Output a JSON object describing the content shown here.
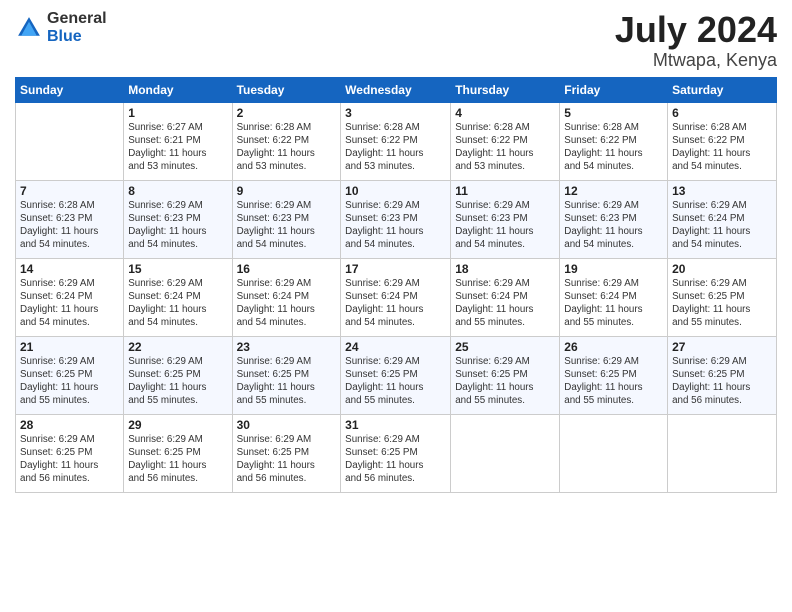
{
  "logo": {
    "general": "General",
    "blue": "Blue"
  },
  "title": {
    "month": "July 2024",
    "location": "Mtwapa, Kenya"
  },
  "headers": [
    "Sunday",
    "Monday",
    "Tuesday",
    "Wednesday",
    "Thursday",
    "Friday",
    "Saturday"
  ],
  "weeks": [
    [
      {
        "day": "",
        "info": ""
      },
      {
        "day": "1",
        "info": "Sunrise: 6:27 AM\nSunset: 6:21 PM\nDaylight: 11 hours\nand 53 minutes."
      },
      {
        "day": "2",
        "info": "Sunrise: 6:28 AM\nSunset: 6:22 PM\nDaylight: 11 hours\nand 53 minutes."
      },
      {
        "day": "3",
        "info": "Sunrise: 6:28 AM\nSunset: 6:22 PM\nDaylight: 11 hours\nand 53 minutes."
      },
      {
        "day": "4",
        "info": "Sunrise: 6:28 AM\nSunset: 6:22 PM\nDaylight: 11 hours\nand 53 minutes."
      },
      {
        "day": "5",
        "info": "Sunrise: 6:28 AM\nSunset: 6:22 PM\nDaylight: 11 hours\nand 54 minutes."
      },
      {
        "day": "6",
        "info": "Sunrise: 6:28 AM\nSunset: 6:22 PM\nDaylight: 11 hours\nand 54 minutes."
      }
    ],
    [
      {
        "day": "7",
        "info": "Sunrise: 6:28 AM\nSunset: 6:23 PM\nDaylight: 11 hours\nand 54 minutes."
      },
      {
        "day": "8",
        "info": "Sunrise: 6:29 AM\nSunset: 6:23 PM\nDaylight: 11 hours\nand 54 minutes."
      },
      {
        "day": "9",
        "info": "Sunrise: 6:29 AM\nSunset: 6:23 PM\nDaylight: 11 hours\nand 54 minutes."
      },
      {
        "day": "10",
        "info": "Sunrise: 6:29 AM\nSunset: 6:23 PM\nDaylight: 11 hours\nand 54 minutes."
      },
      {
        "day": "11",
        "info": "Sunrise: 6:29 AM\nSunset: 6:23 PM\nDaylight: 11 hours\nand 54 minutes."
      },
      {
        "day": "12",
        "info": "Sunrise: 6:29 AM\nSunset: 6:23 PM\nDaylight: 11 hours\nand 54 minutes."
      },
      {
        "day": "13",
        "info": "Sunrise: 6:29 AM\nSunset: 6:24 PM\nDaylight: 11 hours\nand 54 minutes."
      }
    ],
    [
      {
        "day": "14",
        "info": "Sunrise: 6:29 AM\nSunset: 6:24 PM\nDaylight: 11 hours\nand 54 minutes."
      },
      {
        "day": "15",
        "info": "Sunrise: 6:29 AM\nSunset: 6:24 PM\nDaylight: 11 hours\nand 54 minutes."
      },
      {
        "day": "16",
        "info": "Sunrise: 6:29 AM\nSunset: 6:24 PM\nDaylight: 11 hours\nand 54 minutes."
      },
      {
        "day": "17",
        "info": "Sunrise: 6:29 AM\nSunset: 6:24 PM\nDaylight: 11 hours\nand 54 minutes."
      },
      {
        "day": "18",
        "info": "Sunrise: 6:29 AM\nSunset: 6:24 PM\nDaylight: 11 hours\nand 55 minutes."
      },
      {
        "day": "19",
        "info": "Sunrise: 6:29 AM\nSunset: 6:24 PM\nDaylight: 11 hours\nand 55 minutes."
      },
      {
        "day": "20",
        "info": "Sunrise: 6:29 AM\nSunset: 6:25 PM\nDaylight: 11 hours\nand 55 minutes."
      }
    ],
    [
      {
        "day": "21",
        "info": "Sunrise: 6:29 AM\nSunset: 6:25 PM\nDaylight: 11 hours\nand 55 minutes."
      },
      {
        "day": "22",
        "info": "Sunrise: 6:29 AM\nSunset: 6:25 PM\nDaylight: 11 hours\nand 55 minutes."
      },
      {
        "day": "23",
        "info": "Sunrise: 6:29 AM\nSunset: 6:25 PM\nDaylight: 11 hours\nand 55 minutes."
      },
      {
        "day": "24",
        "info": "Sunrise: 6:29 AM\nSunset: 6:25 PM\nDaylight: 11 hours\nand 55 minutes."
      },
      {
        "day": "25",
        "info": "Sunrise: 6:29 AM\nSunset: 6:25 PM\nDaylight: 11 hours\nand 55 minutes."
      },
      {
        "day": "26",
        "info": "Sunrise: 6:29 AM\nSunset: 6:25 PM\nDaylight: 11 hours\nand 55 minutes."
      },
      {
        "day": "27",
        "info": "Sunrise: 6:29 AM\nSunset: 6:25 PM\nDaylight: 11 hours\nand 56 minutes."
      }
    ],
    [
      {
        "day": "28",
        "info": "Sunrise: 6:29 AM\nSunset: 6:25 PM\nDaylight: 11 hours\nand 56 minutes."
      },
      {
        "day": "29",
        "info": "Sunrise: 6:29 AM\nSunset: 6:25 PM\nDaylight: 11 hours\nand 56 minutes."
      },
      {
        "day": "30",
        "info": "Sunrise: 6:29 AM\nSunset: 6:25 PM\nDaylight: 11 hours\nand 56 minutes."
      },
      {
        "day": "31",
        "info": "Sunrise: 6:29 AM\nSunset: 6:25 PM\nDaylight: 11 hours\nand 56 minutes."
      },
      {
        "day": "",
        "info": ""
      },
      {
        "day": "",
        "info": ""
      },
      {
        "day": "",
        "info": ""
      }
    ]
  ]
}
